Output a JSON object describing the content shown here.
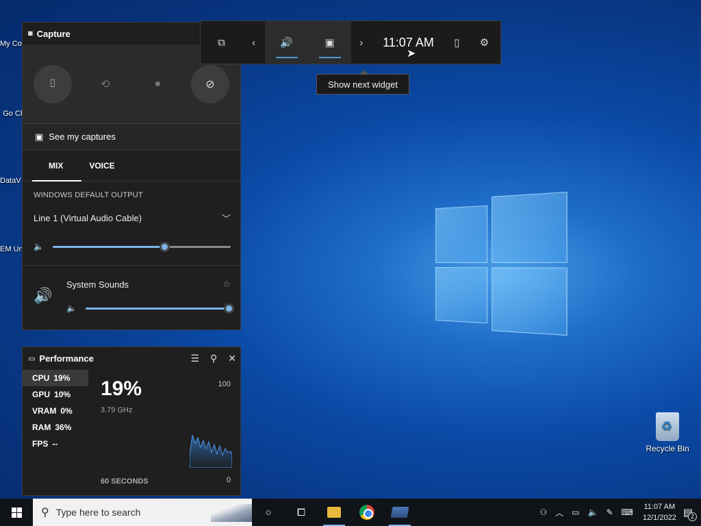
{
  "desktop": {
    "left_icons": [
      "My Co",
      "Go Ch",
      "DataV",
      "EM UnLo"
    ],
    "recycle_bin": "Recycle Bin"
  },
  "gamebar": {
    "clock": "11:07 AM",
    "tooltip": "Show next widget",
    "icons": [
      "widget-menu-icon",
      "chevron-left-icon",
      "audio-icon",
      "capture-icon",
      "chevron-right-icon",
      "mouse-icon",
      "gear-icon"
    ]
  },
  "capture": {
    "title": "Capture",
    "see_captures": "See my captures"
  },
  "audio": {
    "tabs": [
      "MIX",
      "VOICE"
    ],
    "section_label": "WINDOWS DEFAULT OUTPUT",
    "device": "Line 1 (Virtual Audio Cable)",
    "default_volume": 0.63,
    "system_sounds_label": "System Sounds",
    "system_volume": 1.0
  },
  "performance": {
    "title": "Performance",
    "metrics": [
      {
        "name": "CPU",
        "value": "19%"
      },
      {
        "name": "GPU",
        "value": "10%"
      },
      {
        "name": "VRAM",
        "value": "0%"
      },
      {
        "name": "RAM",
        "value": "36%"
      },
      {
        "name": "FPS",
        "value": "--"
      }
    ],
    "big_value": "19%",
    "freq": "3.79 GHz",
    "max": "100",
    "min": "0",
    "window": "60 SECONDS"
  },
  "taskbar": {
    "search_placeholder": "Type here to search",
    "time": "11:07 AM",
    "date": "12/1/2022",
    "notifications": "2"
  },
  "colors": {
    "accent": "#7db4ea",
    "gamebar_bg": "#1b1b1b",
    "panel_bg": "#1f1f1f",
    "taskbar_bg": "#101318"
  }
}
